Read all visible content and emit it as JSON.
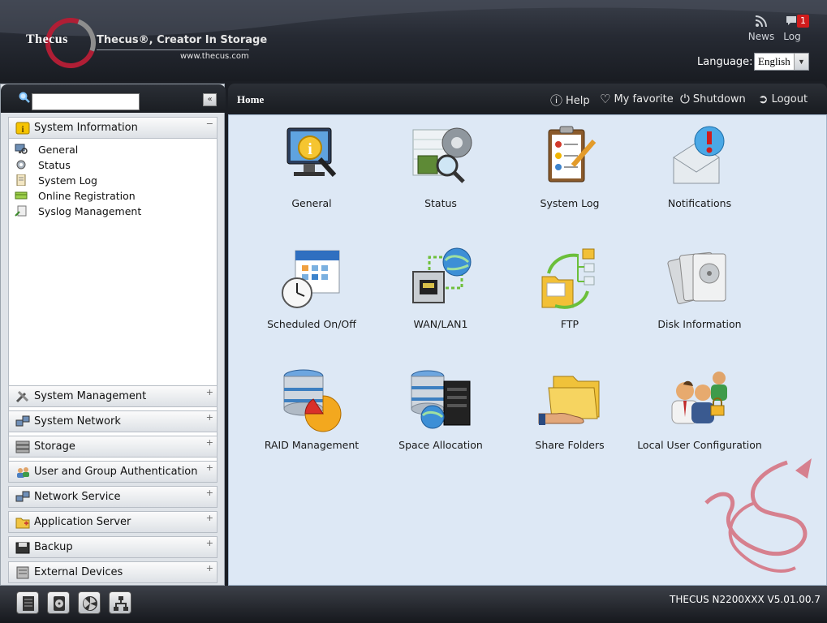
{
  "header": {
    "logo_text": "Thecus",
    "tagline": "Thecus®, Creator In Storage",
    "website": "www.thecus.com",
    "news_label": "News",
    "log_label": "Log",
    "log_badge": "1",
    "language_label": "Language:",
    "language_value": "English"
  },
  "sidebar": {
    "search_placeholder": "",
    "collapse_label": "«",
    "expanded_section": "System Information",
    "expanded_items": [
      {
        "label": "General",
        "icon": "monitor-magnifier-icon"
      },
      {
        "label": "Status",
        "icon": "status-gear-icon"
      },
      {
        "label": "System Log",
        "icon": "log-document-icon"
      },
      {
        "label": "Online Registration",
        "icon": "registration-card-icon"
      },
      {
        "label": "Syslog Management",
        "icon": "syslog-icon"
      }
    ],
    "sections": [
      {
        "label": "System Management",
        "icon": "tools-icon"
      },
      {
        "label": "System Network",
        "icon": "network-icon"
      },
      {
        "label": "Storage",
        "icon": "storage-icon"
      },
      {
        "label": "User and Group Authentication",
        "icon": "users-icon"
      },
      {
        "label": "Network Service",
        "icon": "network-service-icon"
      },
      {
        "label": "Application Server",
        "icon": "folder-app-icon"
      },
      {
        "label": "Backup",
        "icon": "backup-icon"
      },
      {
        "label": "External Devices",
        "icon": "external-device-icon"
      }
    ],
    "expand_symbol": "+",
    "collapse_symbol": "−"
  },
  "main": {
    "breadcrumb": "Home",
    "toolbar": {
      "help": "Help",
      "favorite": "My favorite",
      "shutdown": "Shutdown",
      "logout": "Logout"
    },
    "apps": [
      {
        "label": "General",
        "icon": "monitor-info-icon"
      },
      {
        "label": "Status",
        "icon": "status-chip-icon"
      },
      {
        "label": "System Log",
        "icon": "clipboard-log-icon"
      },
      {
        "label": "Notifications",
        "icon": "envelope-alert-icon"
      },
      {
        "label": "Scheduled On/Off",
        "icon": "calendar-clock-icon"
      },
      {
        "label": "WAN/LAN1",
        "icon": "ethernet-globe-icon"
      },
      {
        "label": "FTP",
        "icon": "ftp-folder-icon"
      },
      {
        "label": "Disk Information",
        "icon": "disk-stack-icon"
      },
      {
        "label": "RAID Management",
        "icon": "database-pie-icon"
      },
      {
        "label": "Space Allocation",
        "icon": "database-server-icon"
      },
      {
        "label": "Share Folders",
        "icon": "hand-folder-icon"
      },
      {
        "label": "Local User Configuration",
        "icon": "users-lock-icon"
      }
    ]
  },
  "status_bar": {
    "buttons": [
      {
        "icon": "server-icon"
      },
      {
        "icon": "disk-icon"
      },
      {
        "icon": "fan-icon"
      },
      {
        "icon": "network-tree-icon"
      }
    ],
    "version": "THECUS N2200XXX V5.01.00.7"
  },
  "colors": {
    "header_dark": "#191c22",
    "content_bg": "#dde8f5",
    "logo_red": "#b01e35",
    "badge_red": "#d01c1c"
  }
}
